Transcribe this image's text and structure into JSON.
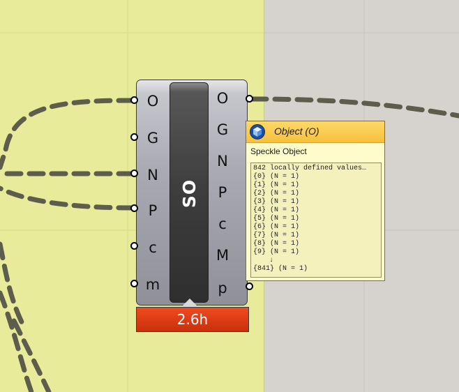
{
  "component": {
    "nickname": "SO",
    "inputs": [
      "O",
      "G",
      "N",
      "P",
      "c",
      "m"
    ],
    "outputs": [
      "O",
      "G",
      "N",
      "P",
      "c",
      "M",
      "p"
    ],
    "runtime": "2.6h"
  },
  "tooltip": {
    "title": "Object (O)",
    "description": "Speckle Object",
    "summary": "842 locally defined values…",
    "items": [
      "{0} (N = 1)",
      "{1} (N = 1)",
      "{2} (N = 1)",
      "{3} (N = 1)",
      "{4} (N = 1)",
      "{5} (N = 1)",
      "{6} (N = 1)",
      "{7} (N = 1)",
      "{8} (N = 1)",
      "{9} (N = 1)"
    ],
    "ellipsis": "↓",
    "last_item": "{841} (N = 1)",
    "icon": "speckle-cube-icon"
  },
  "colors": {
    "group_background": "#e8eb9a",
    "canvas_background": "#d6d2cd",
    "runtime_bar": "#e0401a",
    "tooltip_header": "#f6c13b",
    "wire": "#5d5d4c"
  }
}
